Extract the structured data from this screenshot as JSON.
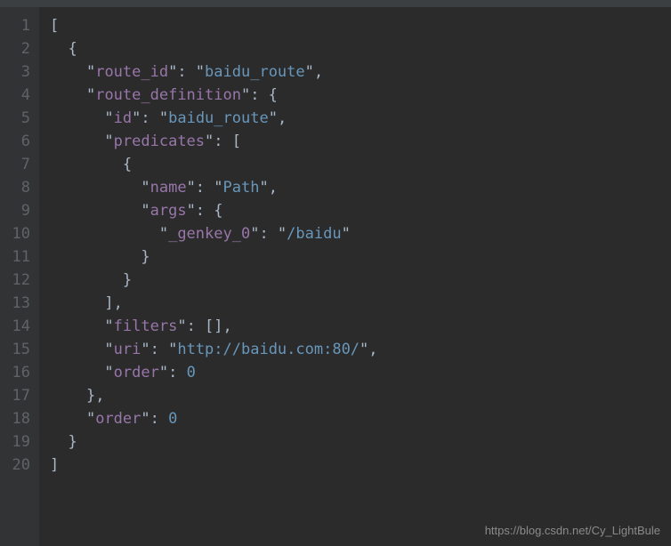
{
  "lines": [
    {
      "num": "1",
      "indent": 0,
      "tokens": [
        {
          "t": "punct",
          "v": "["
        }
      ]
    },
    {
      "num": "2",
      "indent": 1,
      "tokens": [
        {
          "t": "punct",
          "v": "{"
        }
      ]
    },
    {
      "num": "3",
      "indent": 2,
      "tokens": [
        {
          "t": "punct",
          "v": "\""
        },
        {
          "t": "key",
          "v": "route_id"
        },
        {
          "t": "punct",
          "v": "\": \""
        },
        {
          "t": "str-link",
          "v": "baidu_route"
        },
        {
          "t": "punct",
          "v": "\","
        }
      ]
    },
    {
      "num": "4",
      "indent": 2,
      "tokens": [
        {
          "t": "punct",
          "v": "\""
        },
        {
          "t": "key",
          "v": "route_definition"
        },
        {
          "t": "punct",
          "v": "\": {"
        }
      ]
    },
    {
      "num": "5",
      "indent": 3,
      "tokens": [
        {
          "t": "punct",
          "v": "\""
        },
        {
          "t": "key",
          "v": "id"
        },
        {
          "t": "punct",
          "v": "\": \""
        },
        {
          "t": "str-link",
          "v": "baidu_route"
        },
        {
          "t": "punct",
          "v": "\","
        }
      ]
    },
    {
      "num": "6",
      "indent": 3,
      "tokens": [
        {
          "t": "punct",
          "v": "\""
        },
        {
          "t": "key",
          "v": "predicates"
        },
        {
          "t": "punct",
          "v": "\": ["
        }
      ]
    },
    {
      "num": "7",
      "indent": 4,
      "tokens": [
        {
          "t": "punct",
          "v": "{"
        }
      ]
    },
    {
      "num": "8",
      "indent": 5,
      "tokens": [
        {
          "t": "punct",
          "v": "\""
        },
        {
          "t": "key",
          "v": "name"
        },
        {
          "t": "punct",
          "v": "\": \""
        },
        {
          "t": "str-link",
          "v": "Path"
        },
        {
          "t": "punct",
          "v": "\","
        }
      ]
    },
    {
      "num": "9",
      "indent": 5,
      "tokens": [
        {
          "t": "punct",
          "v": "\""
        },
        {
          "t": "key",
          "v": "args"
        },
        {
          "t": "punct",
          "v": "\": {"
        }
      ]
    },
    {
      "num": "10",
      "indent": 6,
      "tokens": [
        {
          "t": "punct",
          "v": "\""
        },
        {
          "t": "key",
          "v": "_genkey_0"
        },
        {
          "t": "punct",
          "v": "\": \""
        },
        {
          "t": "str-link",
          "v": "/baidu"
        },
        {
          "t": "punct",
          "v": "\""
        }
      ]
    },
    {
      "num": "11",
      "indent": 5,
      "tokens": [
        {
          "t": "punct",
          "v": "}"
        }
      ]
    },
    {
      "num": "12",
      "indent": 4,
      "tokens": [
        {
          "t": "punct",
          "v": "}"
        }
      ]
    },
    {
      "num": "13",
      "indent": 3,
      "tokens": [
        {
          "t": "punct",
          "v": "],"
        }
      ]
    },
    {
      "num": "14",
      "indent": 3,
      "tokens": [
        {
          "t": "punct",
          "v": "\""
        },
        {
          "t": "key",
          "v": "filters"
        },
        {
          "t": "punct",
          "v": "\": [],"
        }
      ]
    },
    {
      "num": "15",
      "indent": 3,
      "tokens": [
        {
          "t": "punct",
          "v": "\""
        },
        {
          "t": "key",
          "v": "uri"
        },
        {
          "t": "punct",
          "v": "\": \""
        },
        {
          "t": "str-link",
          "v": "http://baidu.com:80/"
        },
        {
          "t": "punct",
          "v": "\","
        }
      ]
    },
    {
      "num": "16",
      "indent": 3,
      "tokens": [
        {
          "t": "punct",
          "v": "\""
        },
        {
          "t": "key",
          "v": "order"
        },
        {
          "t": "punct",
          "v": "\": "
        },
        {
          "t": "num",
          "v": "0"
        }
      ]
    },
    {
      "num": "17",
      "indent": 2,
      "tokens": [
        {
          "t": "punct",
          "v": "},"
        }
      ]
    },
    {
      "num": "18",
      "indent": 2,
      "tokens": [
        {
          "t": "punct",
          "v": "\""
        },
        {
          "t": "key",
          "v": "order"
        },
        {
          "t": "punct",
          "v": "\": "
        },
        {
          "t": "num",
          "v": "0"
        }
      ]
    },
    {
      "num": "19",
      "indent": 1,
      "tokens": [
        {
          "t": "punct",
          "v": "}"
        }
      ]
    },
    {
      "num": "20",
      "indent": 0,
      "tokens": [
        {
          "t": "punct",
          "v": "]"
        }
      ]
    }
  ],
  "watermark": "https://blog.csdn.net/Cy_LightBule"
}
